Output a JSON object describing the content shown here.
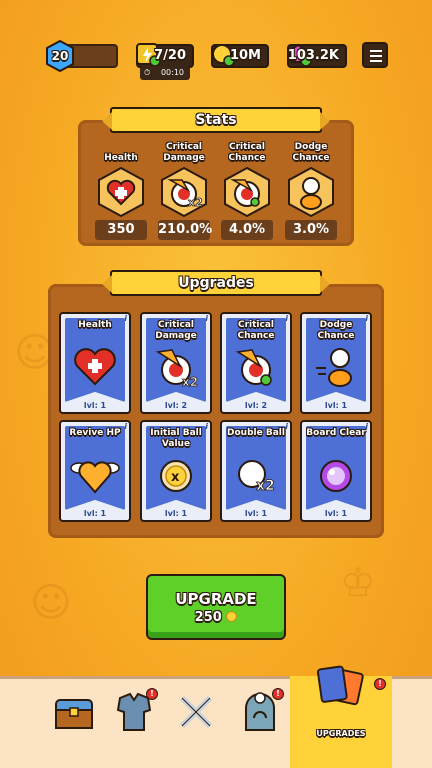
{
  "top_bar": {
    "level": "20",
    "energy": "7/20",
    "energy_timer": "00:10",
    "coins": "10M",
    "gems": "103.2K"
  },
  "stats": {
    "title": "Stats",
    "items": [
      {
        "label": "Health",
        "value": "350",
        "icon": "heart-icon"
      },
      {
        "label": "Critical Damage",
        "value": "210.0%",
        "icon": "critical-damage-icon"
      },
      {
        "label": "Critical Chance",
        "value": "4.0%",
        "icon": "critical-chance-icon"
      },
      {
        "label": "Dodge Chance",
        "value": "3.0%",
        "icon": "dodge-icon"
      }
    ]
  },
  "upgrades": {
    "title": "Upgrades",
    "cards": [
      {
        "name": "Health",
        "level": "lvl: 1",
        "icon": "heart-icon"
      },
      {
        "name": "Critical Damage",
        "level": "lvl: 2",
        "icon": "critical-damage-icon"
      },
      {
        "name": "Critical Chance",
        "level": "lvl: 2",
        "icon": "critical-chance-icon"
      },
      {
        "name": "Dodge Chance",
        "level": "lvl: 1",
        "icon": "dodge-icon"
      },
      {
        "name": "Revive HP",
        "level": "lvl: 1",
        "icon": "winged-heart-icon"
      },
      {
        "name": "Initial Ball Value",
        "level": "lvl: 1",
        "icon": "coin-x-icon"
      },
      {
        "name": "Double Ball",
        "level": "lvl: 1",
        "icon": "double-ball-icon"
      },
      {
        "name": "Board Clear",
        "level": "lvl: 1",
        "icon": "orb-icon"
      }
    ]
  },
  "upgrade_button": {
    "label": "UPGRADE",
    "cost": "250"
  },
  "bottom_nav": {
    "active_label": "UPGRADES",
    "badge": "!"
  }
}
